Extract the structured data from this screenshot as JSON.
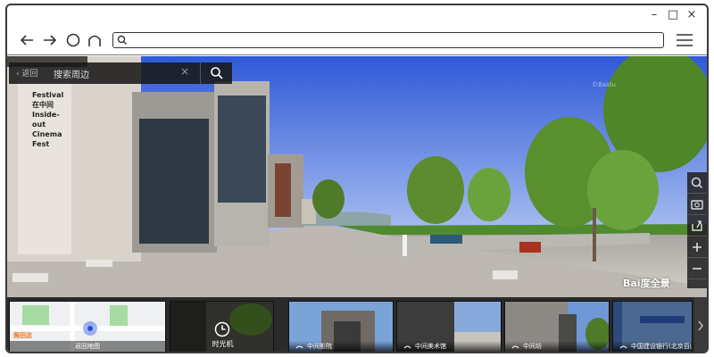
{
  "browser": {
    "window_controls": [
      "–",
      "□",
      "×"
    ],
    "nav_icons": [
      "back-arrow-icon",
      "forward-arrow-icon",
      "refresh-icon",
      "home-icon"
    ],
    "address_value": "",
    "menu_icon": "hamburger-icon"
  },
  "search": {
    "back_label": "返回",
    "placeholder": "搜索周边",
    "clear_symbol": "×"
  },
  "panorama": {
    "banner_text": "Festival 在中间 Inside-out Cinema Fest",
    "watermark": "©Baidu",
    "brand_en": "Bai",
    "brand_cn": "度全景"
  },
  "toolrail": {
    "icons": [
      "search-icon",
      "camera-icon",
      "share-icon",
      "plus-icon",
      "minus-icon"
    ]
  },
  "filmstrip": {
    "map": {
      "pin_label": "照田店",
      "caption": "返回地图"
    },
    "timemachine": {
      "label": "时光机"
    },
    "thumbs": [
      {
        "caption": "中间影院"
      },
      {
        "caption": "中间美术馆"
      },
      {
        "caption": "中间坊"
      },
      {
        "caption": "中国建设银行(北京百山路"
      }
    ]
  },
  "colors": {
    "sky_top": "#2f59d8",
    "sky_bottom": "#a9bff0",
    "accent_orange": "#e6751a"
  }
}
